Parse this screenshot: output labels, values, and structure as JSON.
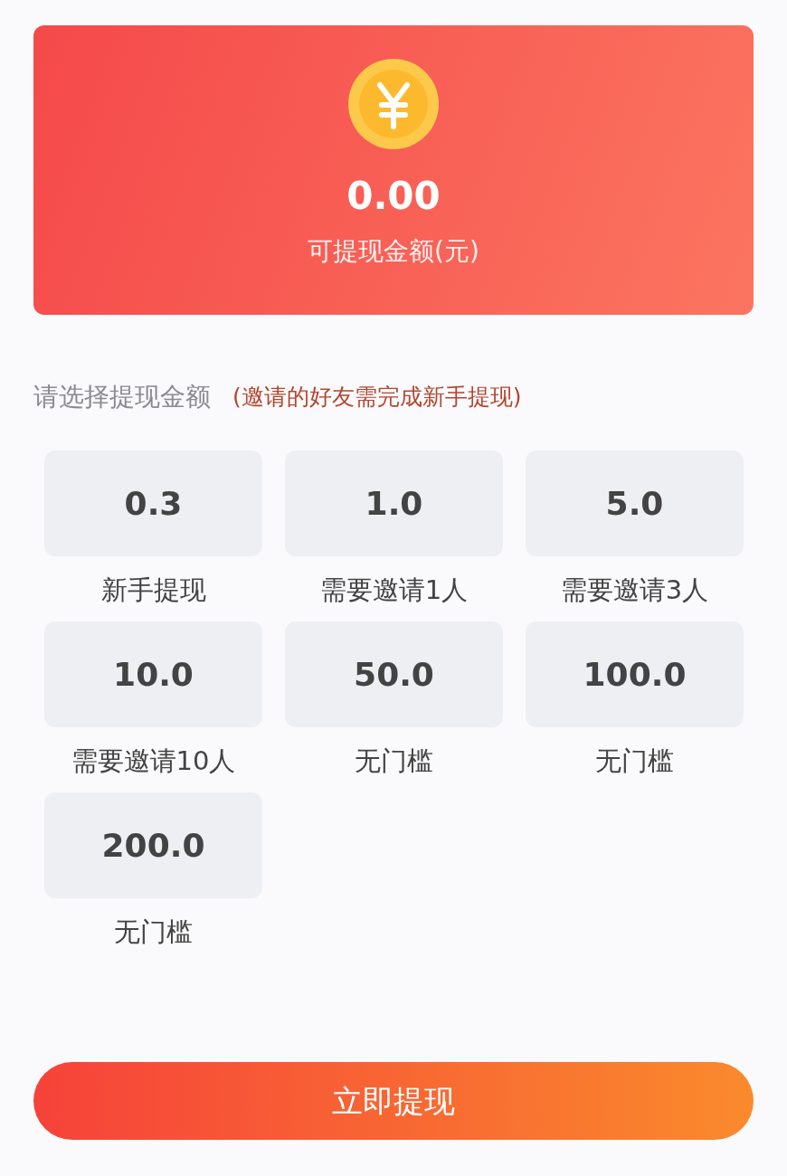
{
  "balance": {
    "amount": "0.00",
    "label": "可提现金额(元)"
  },
  "section": {
    "title": "请选择提现金额",
    "note": "(邀请的好友需完成新手提现)"
  },
  "options": [
    {
      "amount": "0.3",
      "condition": "新手提现"
    },
    {
      "amount": "1.0",
      "condition": "需要邀请1人"
    },
    {
      "amount": "5.0",
      "condition": "需要邀请3人"
    },
    {
      "amount": "10.0",
      "condition": "需要邀请10人"
    },
    {
      "amount": "50.0",
      "condition": "无门槛"
    },
    {
      "amount": "100.0",
      "condition": "无门槛"
    },
    {
      "amount": "200.0",
      "condition": "无门槛"
    }
  ],
  "submit_button": "立即提现"
}
